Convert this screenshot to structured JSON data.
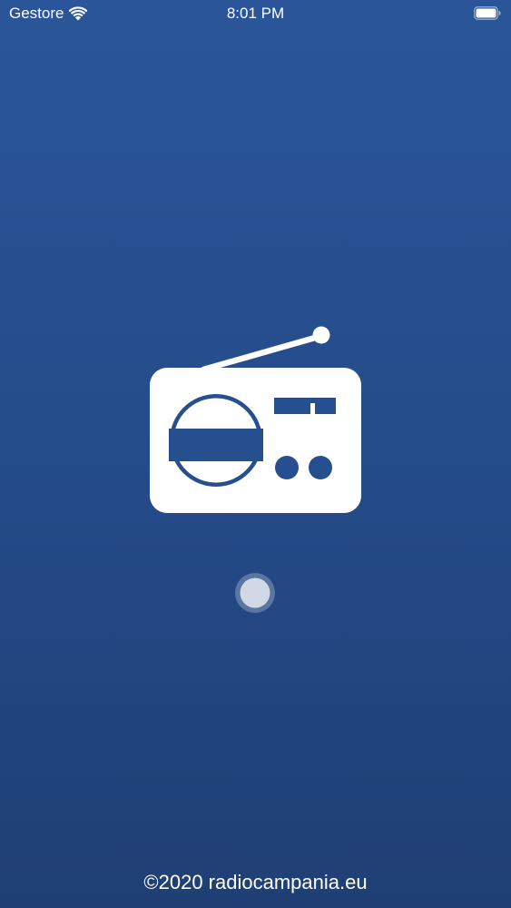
{
  "status_bar": {
    "carrier": "Gestore",
    "time": "8:01 PM",
    "wifi_icon": "wifi-icon",
    "battery_icon": "battery-full-icon"
  },
  "splash": {
    "logo_icon": "radio-icon",
    "spinner_icon": "loading-indicator",
    "background_top": "#2a5699",
    "background_bottom": "#1f3f74",
    "logo_color": "#ffffff",
    "logo_accent": "#254f8e"
  },
  "footer": {
    "copyright": "©2020 radiocampania.eu"
  }
}
